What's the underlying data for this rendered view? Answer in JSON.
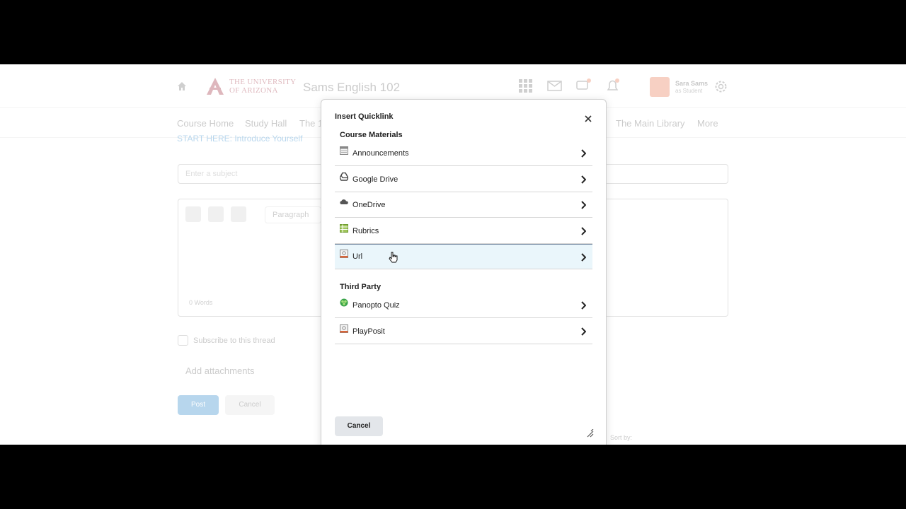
{
  "background": {
    "university_line1": "THE UNIVERSITY",
    "university_line2": "OF ARIZONA",
    "course_title": "Sams English 102",
    "user_name": "Sara Sams",
    "user_role": "as Student",
    "nav": [
      "Course Home",
      "Study Hall",
      "The 1",
      "The Main Library",
      "More"
    ],
    "breadcrumb": "START HERE: Introduce Yourself",
    "subject_placeholder": "Enter a subject",
    "paragraph_label": "Paragraph",
    "words": "0 Words",
    "subscribe_label": "Subscribe to this thread",
    "attach_label": "Add attachments",
    "post_label": "Post",
    "cancel_label": "Cancel",
    "sort_label": "Sort by:"
  },
  "dialog": {
    "title": "Insert Quicklink",
    "sections": [
      {
        "heading": "Course Materials",
        "items": [
          {
            "label": "Announcements",
            "icon": "announcements-icon"
          },
          {
            "label": "Google Drive",
            "icon": "google-drive-icon"
          },
          {
            "label": "OneDrive",
            "icon": "onedrive-icon"
          },
          {
            "label": "Rubrics",
            "icon": "rubrics-icon"
          },
          {
            "label": "Url",
            "icon": "url-icon"
          }
        ]
      },
      {
        "heading": "Third Party",
        "items": [
          {
            "label": "Panopto Quiz",
            "icon": "panopto-icon"
          },
          {
            "label": "PlayPosit",
            "icon": "playposit-icon"
          }
        ]
      }
    ],
    "cancel_label": "Cancel"
  },
  "colors": {
    "hover_row": "#eaf6fb",
    "brand_red": "#8b0015",
    "link_blue": "#006fbf"
  }
}
